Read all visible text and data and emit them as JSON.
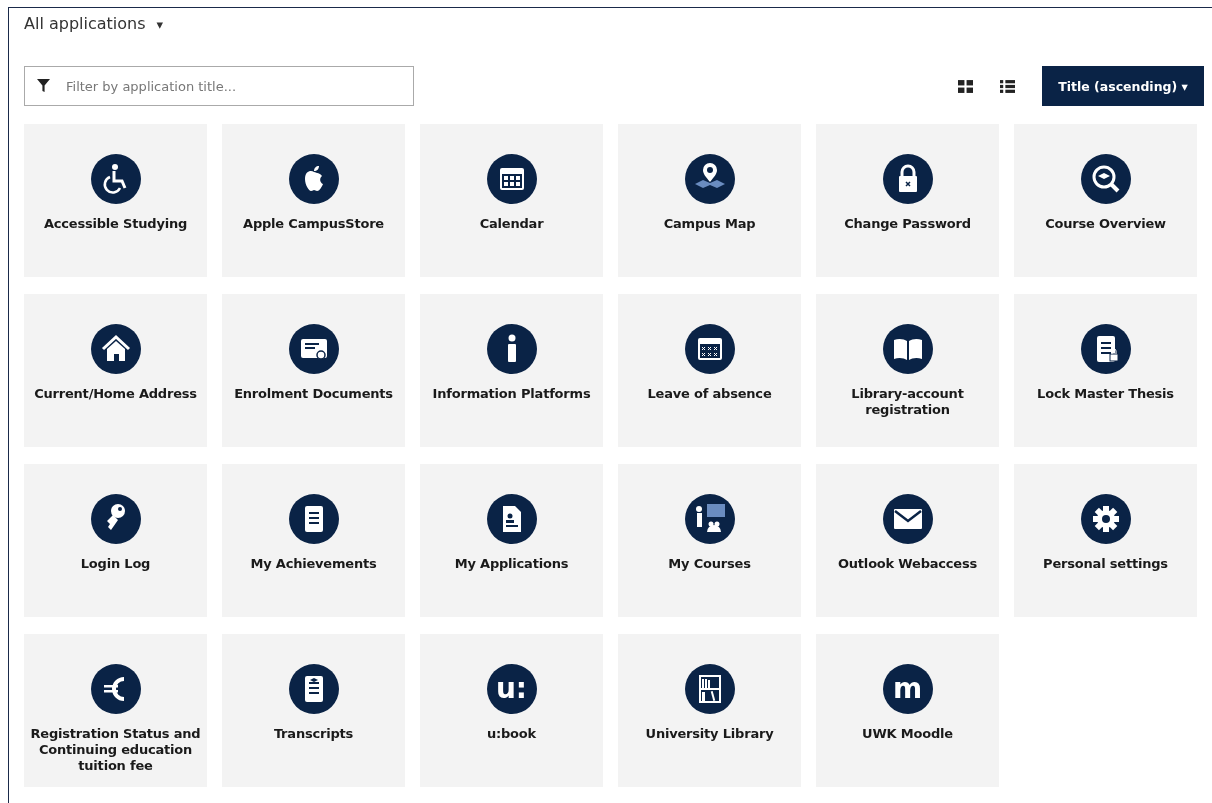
{
  "header": {
    "title": "All applications",
    "caret": "▾"
  },
  "filter": {
    "placeholder": "Filter by application title..."
  },
  "sort_button": {
    "label": "Title (ascending)",
    "caret": "▾"
  },
  "tiles": [
    {
      "label": "Accessible Studying"
    },
    {
      "label": "Apple CampusStore"
    },
    {
      "label": "Calendar"
    },
    {
      "label": "Campus Map"
    },
    {
      "label": "Change Password"
    },
    {
      "label": "Course Overview"
    },
    {
      "label": "Current/Home Address"
    },
    {
      "label": "Enrolment Documents"
    },
    {
      "label": "Information Platforms"
    },
    {
      "label": "Leave of absence"
    },
    {
      "label": "Library-account registration"
    },
    {
      "label": "Lock Master Thesis"
    },
    {
      "label": "Login Log"
    },
    {
      "label": "My Achievements"
    },
    {
      "label": "My Applications"
    },
    {
      "label": "My Courses"
    },
    {
      "label": "Outlook Webaccess"
    },
    {
      "label": "Personal settings"
    },
    {
      "label": "Registration Status and Continuing education tuition fee"
    },
    {
      "label": "Transcripts"
    },
    {
      "label": "u:book",
      "glyph": "u:"
    },
    {
      "label": "University Library"
    },
    {
      "label": "UWK Moodle",
      "glyph": "m"
    }
  ]
}
